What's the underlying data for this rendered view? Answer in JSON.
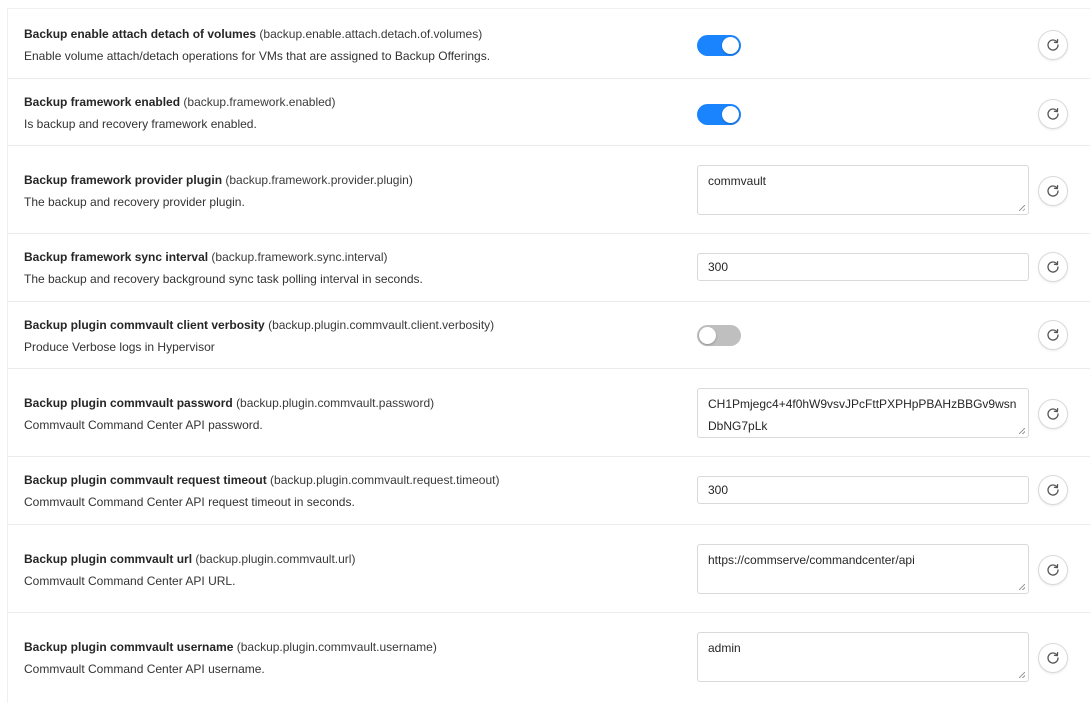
{
  "settings": [
    {
      "name": "Backup enable attach detach of volumes",
      "key": "(backup.enable.attach.detach.of.volumes)",
      "description": "Enable volume attach/detach operations for VMs that are assigned to Backup Offerings.",
      "control": "toggle",
      "enabled": true
    },
    {
      "name": "Backup framework enabled",
      "key": "(backup.framework.enabled)",
      "description": "Is backup and recovery framework enabled.",
      "control": "toggle",
      "enabled": true
    },
    {
      "name": "Backup framework provider plugin",
      "key": "(backup.framework.provider.plugin)",
      "description": "The backup and recovery provider plugin.",
      "control": "textarea",
      "value": "commvault"
    },
    {
      "name": "Backup framework sync interval",
      "key": "(backup.framework.sync.interval)",
      "description": "The backup and recovery background sync task polling interval in seconds.",
      "control": "input",
      "value": "300"
    },
    {
      "name": "Backup plugin commvault client verbosity",
      "key": "(backup.plugin.commvault.client.verbosity)",
      "description": "Produce Verbose logs in Hypervisor",
      "control": "toggle",
      "enabled": false
    },
    {
      "name": "Backup plugin commvault password",
      "key": "(backup.plugin.commvault.password)",
      "description": "Commvault Command Center API password.",
      "control": "textarea",
      "value": "CH1Pmjegc4+4f0hW9vsvJPcFttPXPHpPBAHzBBGv9wsnDbNG7pLk"
    },
    {
      "name": "Backup plugin commvault request timeout",
      "key": "(backup.plugin.commvault.request.timeout)",
      "description": "Commvault Command Center API request timeout in seconds.",
      "control": "input",
      "value": "300"
    },
    {
      "name": "Backup plugin commvault url",
      "key": "(backup.plugin.commvault.url)",
      "description": "Commvault Command Center API URL.",
      "control": "textarea",
      "value": "https://commserve/commandcenter/api"
    },
    {
      "name": "Backup plugin commvault username",
      "key": "(backup.plugin.commvault.username)",
      "description": "Commvault Command Center API username.",
      "control": "textarea",
      "value": "admin"
    }
  ],
  "icons": {
    "reset": "reset-icon"
  },
  "colors": {
    "toggle_on": "#1a84ff",
    "toggle_off": "#bfbfbf"
  }
}
